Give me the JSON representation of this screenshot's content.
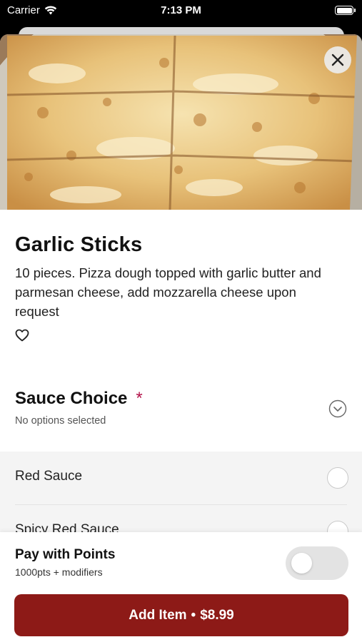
{
  "status_bar": {
    "carrier": "Carrier",
    "time": "7:13 PM"
  },
  "item": {
    "title": "Garlic Sticks",
    "description": "10 pieces. Pizza dough topped with garlic butter and parmesan cheese, add mozzarella cheese upon request"
  },
  "modifier_group": {
    "title": "Sauce Choice",
    "required_marker": "*",
    "subtitle": "No options selected",
    "options": [
      {
        "label": "Red Sauce",
        "selected": false
      },
      {
        "label": "Spicy Red Sauce",
        "selected": false
      }
    ]
  },
  "points": {
    "label": "Pay with Points",
    "subtitle": "1000pts + modifiers",
    "enabled": false
  },
  "add_button": {
    "label": "Add Item",
    "separator": "•",
    "price": "$8.99"
  },
  "colors": {
    "accent": "#8d1a17",
    "required": "#b3134a"
  },
  "icons": {
    "close": "close-icon",
    "favorite": "heart-outline-icon",
    "expand": "chevron-down-circle-icon",
    "wifi": "wifi-icon",
    "battery": "battery-icon"
  }
}
